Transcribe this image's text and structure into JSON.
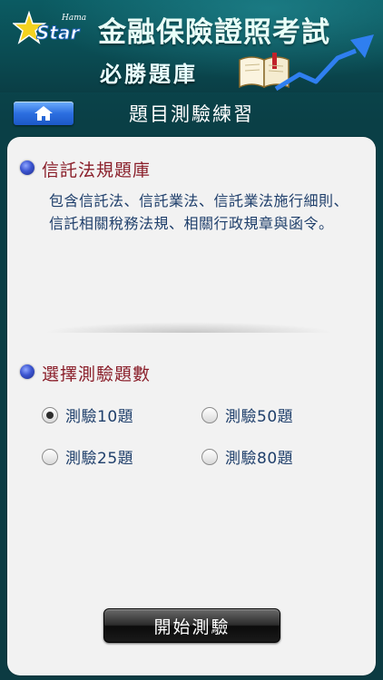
{
  "header": {
    "logo_text": "Star",
    "logo_small": "Hama",
    "title": "金融保險證照考試",
    "subtitle": "必勝題庫"
  },
  "nav": {
    "home_icon": "home-icon",
    "page_title": "題目測驗練習"
  },
  "bank": {
    "title": "信託法規題庫",
    "description": "包含信託法、信託業法、信託業法施行細則、信託相關稅務法規、相關行政規章與函令。"
  },
  "quiz": {
    "title": "選擇測驗題數",
    "options": [
      {
        "label": "測驗10題",
        "checked": true
      },
      {
        "label": "測驗50題",
        "checked": false
      },
      {
        "label": "測驗25題",
        "checked": false
      },
      {
        "label": "測驗80題",
        "checked": false
      }
    ],
    "start_label": "開始測驗"
  },
  "colors": {
    "header_bg": "#0a4b52",
    "section_title": "#8a1f2a",
    "body_text": "#1f3f6b",
    "home_button": "#2c6fe0"
  }
}
